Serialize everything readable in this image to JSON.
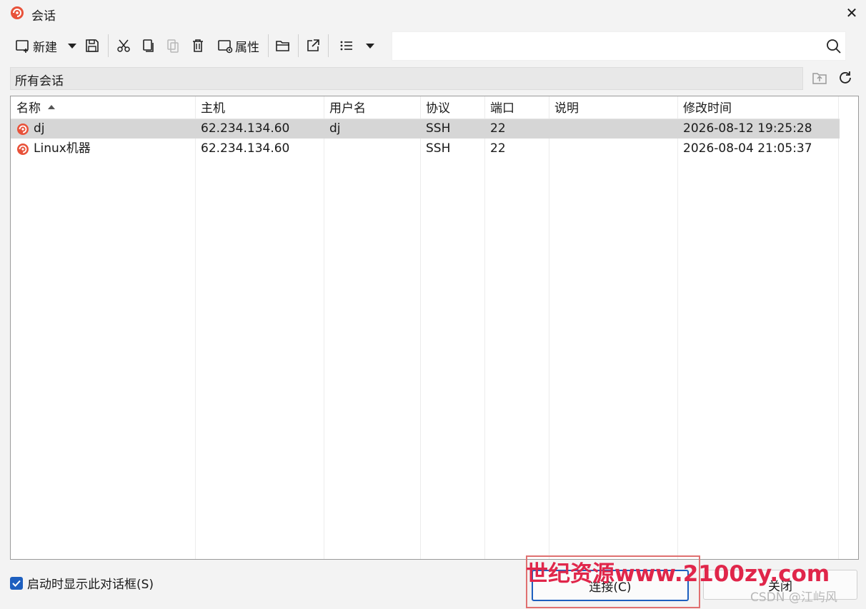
{
  "window": {
    "title": "会话",
    "close_glyph": "✕"
  },
  "toolbar": {
    "new_label": "新建",
    "properties_label": "属性"
  },
  "search": {
    "value": "",
    "placeholder": ""
  },
  "path": {
    "text": "所有会话"
  },
  "columns": [
    "名称",
    "主机",
    "用户名",
    "协议",
    "端口",
    "说明",
    "修改时间"
  ],
  "rows": [
    {
      "name": "dj",
      "host": "62.234.134.60",
      "user": "dj",
      "protocol": "SSH",
      "port": "22",
      "desc": "",
      "modified": "2026-08-12 19:25:28",
      "selected": true
    },
    {
      "name": "Linux机器",
      "host": "62.234.134.60",
      "user": "",
      "protocol": "SSH",
      "port": "22",
      "desc": "",
      "modified": "2026-08-04 21:05:37",
      "selected": false
    }
  ],
  "footer": {
    "show_on_start_label": "启动时显示此对话框(S)",
    "show_on_start_checked": true,
    "connect_label": "连接(C)",
    "close_label": "关闭"
  },
  "watermark": {
    "text": "世纪资源www.2100zy.com",
    "csdn": "CSDN @江屿风"
  },
  "colors": {
    "accent": "#1d5fbf",
    "brand": "#e8523a",
    "selected_row": "#d6d6d6"
  }
}
